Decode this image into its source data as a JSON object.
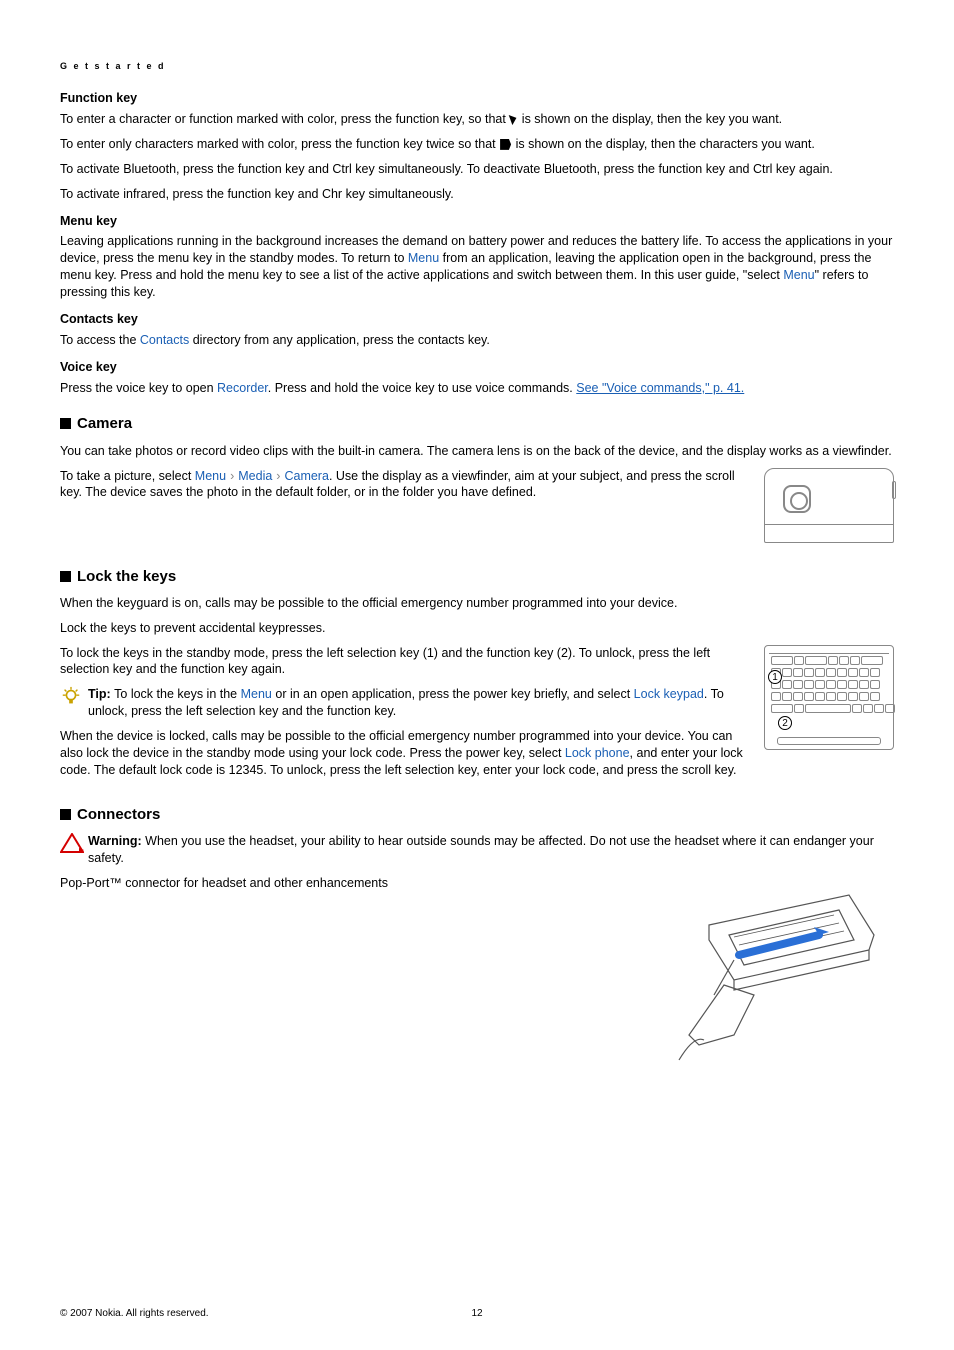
{
  "header": "G e t   s t a r t e d",
  "func": {
    "heading": "Function key",
    "p1a": "To enter a character or function marked with color, press the function key, so that ",
    "p1b": " is shown on the display, then the key you want.",
    "p2a": "To enter only characters marked with color, press the function key twice so that ",
    "p2b": " is shown on the display, then the characters you want.",
    "p3": "To activate Bluetooth, press the function key and Ctrl key simultaneously. To deactivate Bluetooth, press the function key and Ctrl key again.",
    "p4": "To activate infrared, press the function key and Chr key simultaneously."
  },
  "menu": {
    "heading": "Menu key",
    "p1a": "Leaving applications running in the background increases the demand on battery power and reduces the battery life. To access the applications in your device, press the menu key in the standby modes. To return to ",
    "p1_link1": "Menu",
    "p1b": " from an application, leaving the application open in the background, press the menu key. Press and hold the menu key to see a list of the active applications and switch between them. In this user guide, \"select ",
    "p1_link2": "Menu",
    "p1c": "\" refers to pressing this key."
  },
  "contacts": {
    "heading": "Contacts key",
    "pa": "To access the ",
    "link": "Contacts",
    "pb": " directory from any application, press the contacts key."
  },
  "voice": {
    "heading": "Voice key",
    "pa": "Press the voice key to open ",
    "link1": "Recorder",
    "pb": ". Press and hold the voice key to use voice commands. ",
    "link2": "See \"Voice commands,\" p. 41."
  },
  "camera": {
    "title": "Camera",
    "p1": "You can take photos or record video clips with the built-in camera. The camera lens is on the back of the device, and the display works as a viewfinder.",
    "p2a": "To take a picture, select ",
    "m1": "Menu",
    "m2": "Media",
    "m3": "Camera",
    "p2b": ". Use the display as a viewfinder, aim at your subject, and press the scroll key. The device saves the photo in the default folder, or in the folder you have defined."
  },
  "lock": {
    "title": "Lock the keys",
    "p1": "When the keyguard is on, calls may be possible to the official emergency number programmed into your device.",
    "p2": "Lock the keys to prevent accidental keypresses.",
    "p3": "To lock the keys in the standby mode, press the left selection key (1) and the function key (2). To unlock, press the left selection key and the function key again.",
    "tip_label": "Tip: ",
    "tip_a": "To lock the keys in the ",
    "tip_link1": "Menu",
    "tip_b": " or in an open application, press the power key briefly, and select ",
    "tip_link2": "Lock keypad",
    "tip_c": ". To unlock, press the left selection key and the function key.",
    "p4a": "When the device is locked, calls may be possible to the official emergency number programmed into your device. You can also lock the device in the standby mode using your lock code. Press the power key, select ",
    "p4_link": "Lock phone",
    "p4b": ", and enter your lock code. The default lock code is 12345. To unlock, press the left selection key, enter your lock code, and press the scroll key."
  },
  "conn": {
    "title": "Connectors",
    "warn_label": "Warning:  ",
    "warn": "When you use the headset, your ability to hear outside sounds may be affected. Do not use the headset where it can endanger your safety.",
    "p1": "Pop-Port™ connector for headset and other enhancements"
  },
  "keys_diagram": {
    "c1": "1",
    "c2": "2"
  },
  "footer": {
    "copyright": "© 2007 Nokia. All rights reserved.",
    "page": "12"
  }
}
